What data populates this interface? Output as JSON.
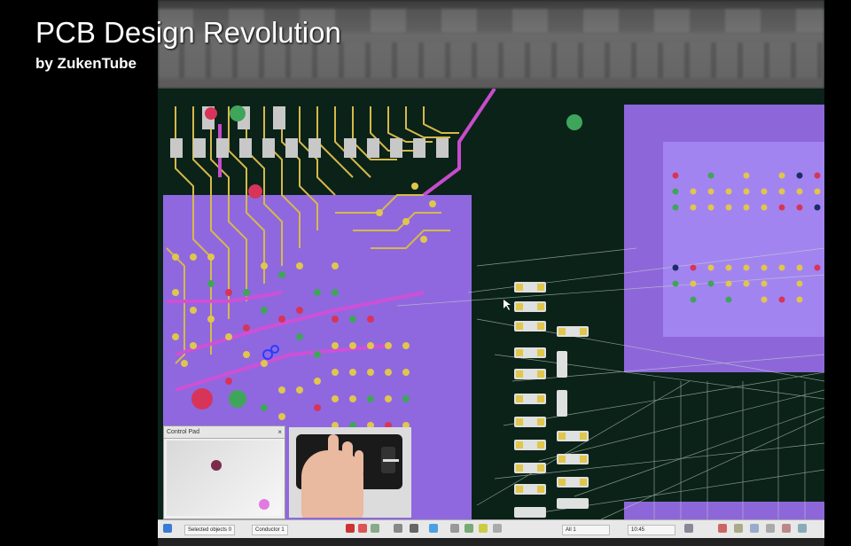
{
  "video": {
    "title": "PCB Design Revolution",
    "subtitle": "by ZukenTube"
  },
  "control_pad": {
    "title": "Control Pad",
    "close_icon": "close-icon",
    "dot_colors": [
      "#7a2c4a",
      "#e07ae0"
    ]
  },
  "statusbar": {
    "selected_objects": "Selected objects 0",
    "conductor": "Conductor 1",
    "field1": "All 1",
    "field2": "10:45"
  },
  "colors": {
    "board": "#0b2219",
    "copper": "#9b6ff0",
    "trace_magenta": "#d24fd6",
    "trace_gold": "#d6b94a",
    "pad_gold": "#e0c64c",
    "pad_green": "#3fa55a",
    "pad_red": "#d8345a",
    "ratsnest": "#c8d8c8"
  }
}
